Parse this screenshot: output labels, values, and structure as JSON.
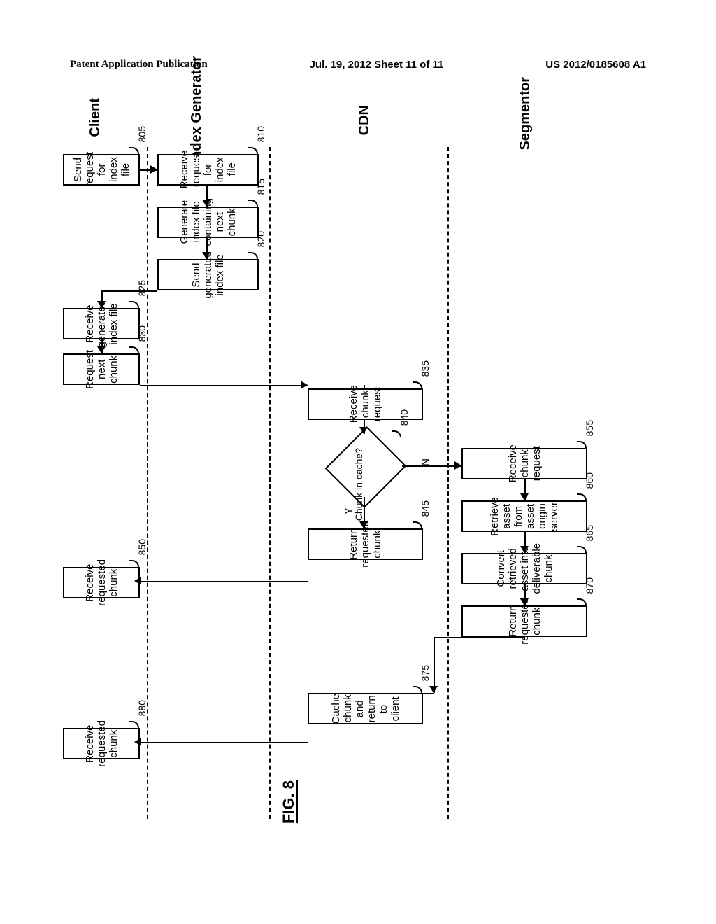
{
  "header": {
    "left": "Patent Application Publication",
    "center": "Jul. 19, 2012  Sheet 11 of 11",
    "right": "US 2012/0185608 A1"
  },
  "lanes": {
    "client": "Client",
    "index_generator": "Index Generator",
    "cdn": "CDN",
    "segmentor": "Segmentor"
  },
  "boxes": {
    "b805": "Send request for index file",
    "b810": "Receive request for index file",
    "b815": "Generate index file containing next chunk",
    "b820": "Send generated index file",
    "b825": "Receive generated index file",
    "b830": "Request next chunk",
    "b835": "Receive chunk request",
    "b840": "Chunk in cache?",
    "b845": "Return requested chunk",
    "b850": "Receive requested chunk",
    "b855": "Receive chunk request",
    "b860": "Retrieve asset from asset origin server",
    "b865": "Convert retrieved asset into deliverable chunk",
    "b870": "Return requested chunk",
    "b875": "Cache chunk and return to client",
    "b880": "Receive requested chunk"
  },
  "refs": {
    "r805": "805",
    "r810": "810",
    "r815": "815",
    "r820": "820",
    "r825": "825",
    "r830": "830",
    "r835": "835",
    "r840": "840",
    "r845": "845",
    "r850": "850",
    "r855": "855",
    "r860": "860",
    "r865": "865",
    "r870": "870",
    "r875": "875",
    "r880": "880"
  },
  "decision": {
    "yes": "Y",
    "no": "N"
  },
  "figure_label": "FIG. 8"
}
